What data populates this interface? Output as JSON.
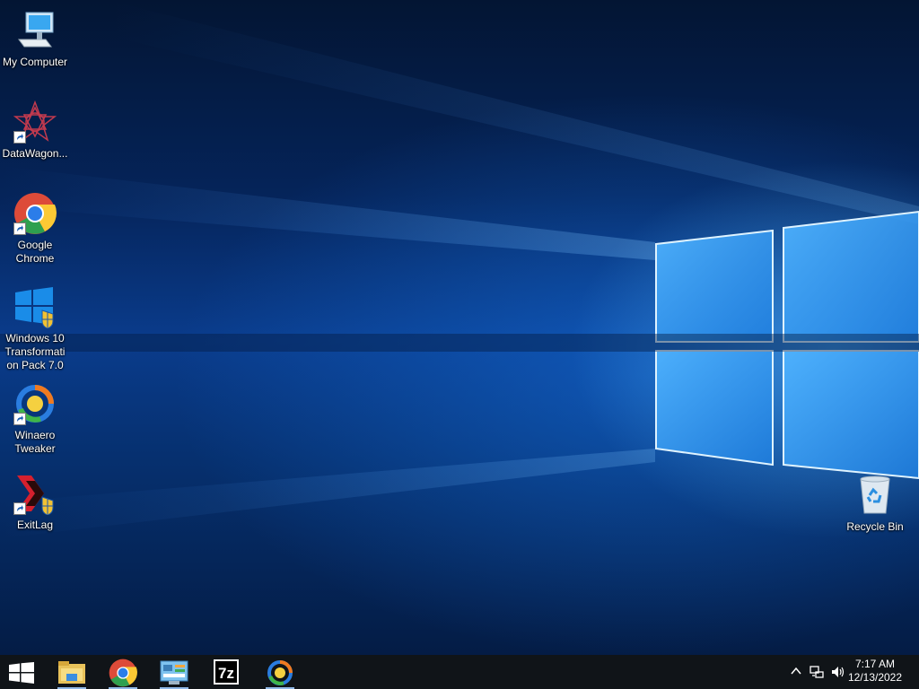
{
  "desktop": {
    "icons": [
      {
        "label": "My Computer",
        "icon": "computer-icon"
      },
      {
        "label": "DataWagon...",
        "icon": "datawagon-icon"
      },
      {
        "label": "Google\nChrome",
        "icon": "chrome-icon"
      },
      {
        "label": "Windows 10\nTransformati\non Pack 7.0",
        "icon": "windows-transformation-pack-icon"
      },
      {
        "label": "Winaero\nTweaker",
        "icon": "winaero-tweaker-icon"
      },
      {
        "label": "ExitLag",
        "icon": "exitlag-icon"
      },
      {
        "label": "Recycle Bin",
        "icon": "recycle-bin-icon"
      }
    ]
  },
  "taskbar": {
    "start_icon": "windows-logo-icon",
    "pinned": [
      {
        "name": "File Explorer",
        "icon": "file-explorer-icon"
      },
      {
        "name": "Google Chrome",
        "icon": "chrome-icon"
      },
      {
        "name": "Control Panel",
        "icon": "control-panel-icon"
      },
      {
        "name": "7-Zip",
        "icon": "7zip-icon"
      },
      {
        "name": "Winaero Tweaker",
        "icon": "winaero-tweaker-icon"
      }
    ],
    "tray": {
      "icons": [
        "chevron-up-icon",
        "network-icon",
        "volume-icon"
      ],
      "time": "7:17 AM",
      "date": "12/13/2022"
    }
  },
  "colors": {
    "taskbar_bg": "#101418",
    "wallpaper_blue": "#0a3c8c",
    "accent_light": "#8fd0ff"
  }
}
